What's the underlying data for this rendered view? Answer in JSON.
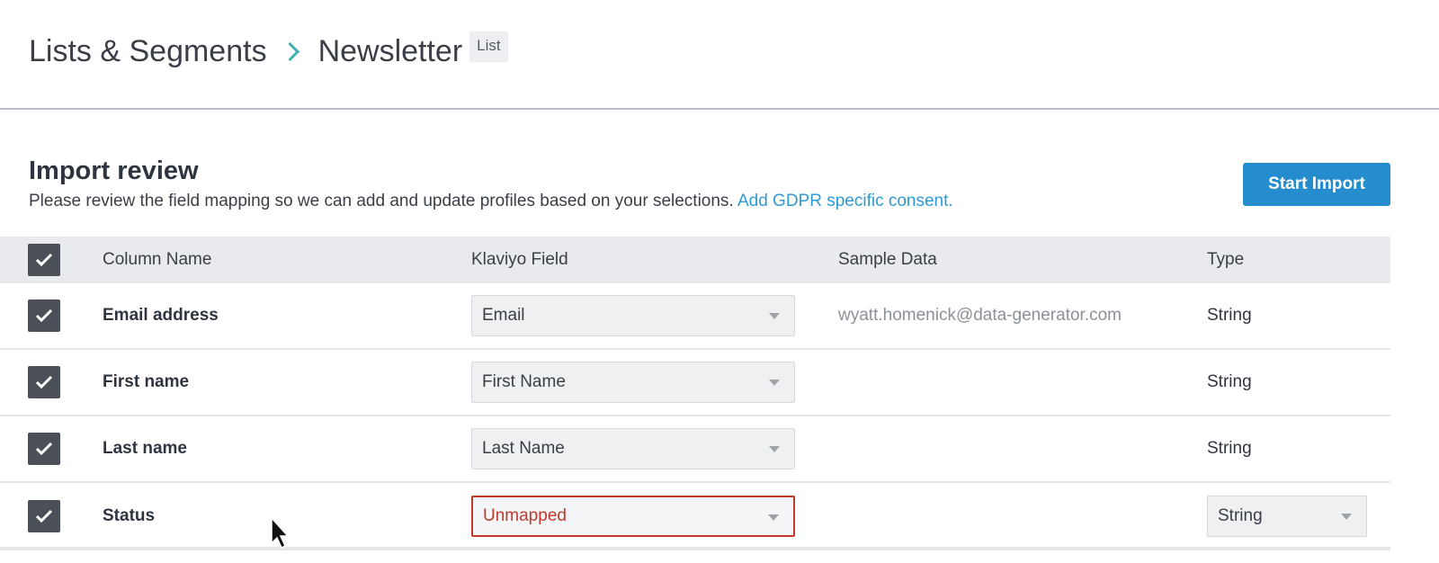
{
  "breadcrumb": {
    "parent": "Lists & Segments",
    "current": "Newsletter",
    "badge": "List"
  },
  "section": {
    "title": "Import review",
    "description": "Please review the field mapping so we can add and update profiles based on your selections.",
    "link": "Add GDPR specific consent.",
    "start_button": "Start Import"
  },
  "table": {
    "headers": {
      "column_name": "Column Name",
      "klaviyo_field": "Klaviyo Field",
      "sample_data": "Sample Data",
      "type": "Type"
    },
    "rows": [
      {
        "checked": true,
        "column_name": "Email address",
        "klaviyo_field": "Email",
        "sample": "wyatt.homenick@data-generator.com",
        "type": "String"
      },
      {
        "checked": true,
        "column_name": "First name",
        "klaviyo_field": "First Name",
        "sample": "",
        "type": "String"
      },
      {
        "checked": true,
        "column_name": "Last name",
        "klaviyo_field": "Last Name",
        "sample": "",
        "type": "String"
      },
      {
        "checked": true,
        "column_name": "Status",
        "klaviyo_field": "Unmapped",
        "sample": "",
        "type": "String"
      }
    ]
  },
  "colors": {
    "accent": "#258ccd",
    "link": "#2f9bd4",
    "error": "#c0392b",
    "breadcrumb_chevron": "#3fb1b5"
  }
}
